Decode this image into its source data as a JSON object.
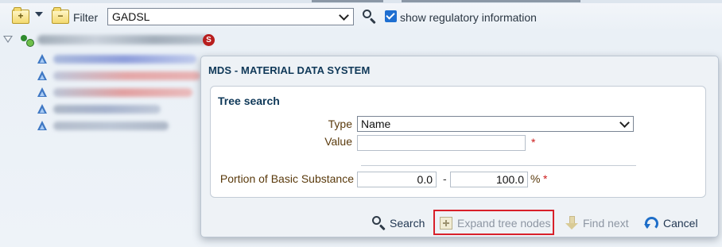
{
  "toolbar": {
    "new_folder_icon": "folder-plus-icon",
    "menu_icon": "dropdown-caret-icon",
    "filter_folder_icon": "folder-minus-icon",
    "filter_label": "Filter",
    "filter_value": "GADSL",
    "search_icon": "magnifier-icon",
    "regulatory_checked": true,
    "regulatory_label": "show regulatory information"
  },
  "tree": {
    "root_badge": "S",
    "node_icon": "blue-pyramid-icon",
    "child_count": 5
  },
  "dialog": {
    "title": "MDS - MATERIAL DATA SYSTEM",
    "section_title": "Tree search",
    "type_label": "Type",
    "type_value": "Name",
    "value_label": "Value",
    "value_value": "",
    "required_mark": "*",
    "portion_label": "Portion of Basic Substance",
    "portion_min": "0.0",
    "portion_sep": "-",
    "portion_max": "100.0",
    "portion_unit": "%",
    "buttons": {
      "search": "Search",
      "expand": "Expand tree nodes",
      "find_next": "Find next",
      "cancel": "Cancel"
    }
  },
  "colors": {
    "accent": "#1e6ec8",
    "title": "#0f3858",
    "label": "#5a3a0c",
    "required": "#cc1b1b",
    "highlight": "#d8202a"
  }
}
